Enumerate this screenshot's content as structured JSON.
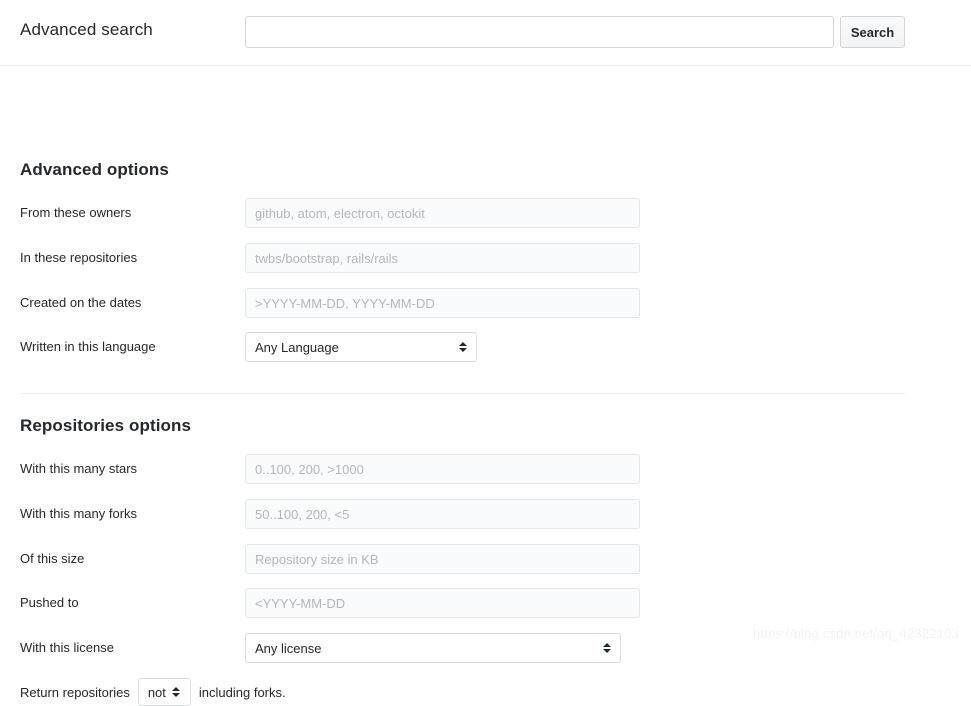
{
  "topbar": {
    "title": "Advanced search",
    "search_value": "",
    "search_placeholder": "",
    "search_button_label": "Search"
  },
  "advanced_options": {
    "heading": "Advanced options",
    "fields": [
      {
        "label": "From these owners",
        "type": "text",
        "value": "",
        "placeholder": "github, atom, electron, octokit"
      },
      {
        "label": "In these repositories",
        "type": "text",
        "value": "",
        "placeholder": "twbs/bootstrap, rails/rails"
      },
      {
        "label": "Created on the dates",
        "type": "text",
        "value": "",
        "placeholder": ">YYYY-MM-DD, YYYY-MM-DD"
      },
      {
        "label": "Written in this language",
        "type": "select",
        "value": "Any Language"
      }
    ]
  },
  "repositories_options": {
    "heading": "Repositories options",
    "fields": [
      {
        "label": "With this many stars",
        "type": "text",
        "value": "",
        "placeholder": "0..100, 200, >1000"
      },
      {
        "label": "With this many forks",
        "type": "text",
        "value": "",
        "placeholder": "50..100, 200, <5"
      },
      {
        "label": "Of this size",
        "type": "text",
        "value": "",
        "placeholder": "Repository size in KB"
      },
      {
        "label": "Pushed to",
        "type": "text",
        "value": "",
        "placeholder": "<YYYY-MM-DD"
      },
      {
        "label": "With this license",
        "type": "select",
        "value": "Any license"
      }
    ],
    "return_row": {
      "prefix": "Return repositories",
      "select_value": "not",
      "suffix": "including forks."
    }
  },
  "watermark": "https://blog.csdn.net/qq_42322103",
  "icons": {
    "select_arrows": "chevron-up-down-icon"
  }
}
